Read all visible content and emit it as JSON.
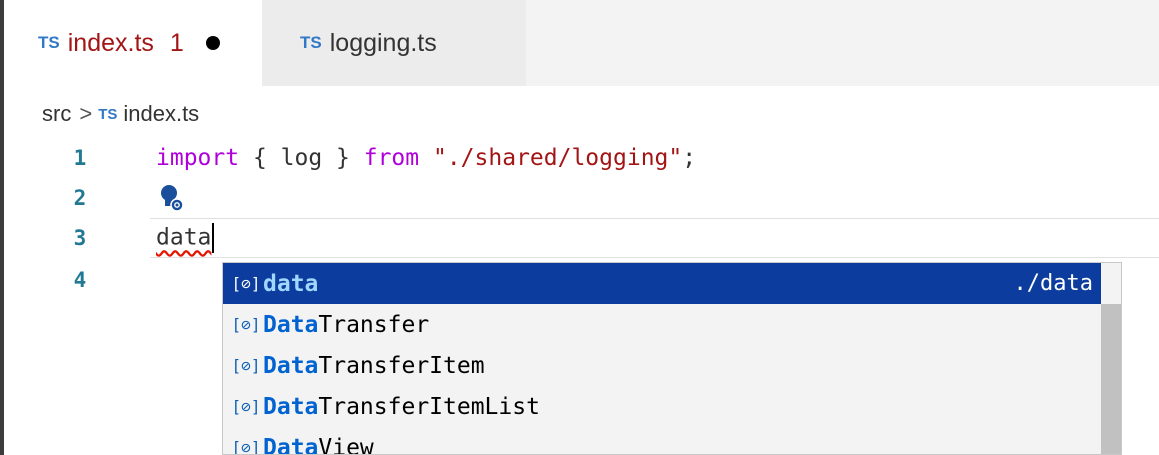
{
  "tabs": [
    {
      "badge": "TS",
      "label": "index.ts",
      "problems": "1",
      "active": true,
      "dirty": true
    },
    {
      "badge": "TS",
      "label": "logging.ts",
      "active": false
    }
  ],
  "breadcrumb": {
    "folder": "src",
    "separator": ">",
    "badge": "TS",
    "file": "index.ts"
  },
  "editor": {
    "lines": [
      {
        "number": "1",
        "kw_import": "import",
        "brace_open": " { ",
        "ident": "log",
        "brace_close": " } ",
        "kw_from": "from",
        "space": " ",
        "string": "\"./shared/logging\"",
        "semicolon": ";"
      },
      {
        "number": "2"
      },
      {
        "number": "3",
        "text": "data"
      },
      {
        "number": "4"
      }
    ]
  },
  "suggestions": {
    "items": [
      {
        "icon": "variable-icon",
        "match": "data",
        "rest": "",
        "detail": "./data",
        "selected": true
      },
      {
        "icon": "variable-icon",
        "match": "Data",
        "rest": "Transfer"
      },
      {
        "icon": "variable-icon",
        "match": "Data",
        "rest": "TransferItem"
      },
      {
        "icon": "variable-icon",
        "match": "Data",
        "rest": "TransferItemList"
      },
      {
        "icon": "variable-icon",
        "match": "Data",
        "rest": "View"
      }
    ]
  },
  "colors": {
    "selection": "#0b3c9e",
    "keyword": "#af00db",
    "string": "#a31515",
    "line_number": "#237893",
    "ts_badge": "#3178c6"
  }
}
